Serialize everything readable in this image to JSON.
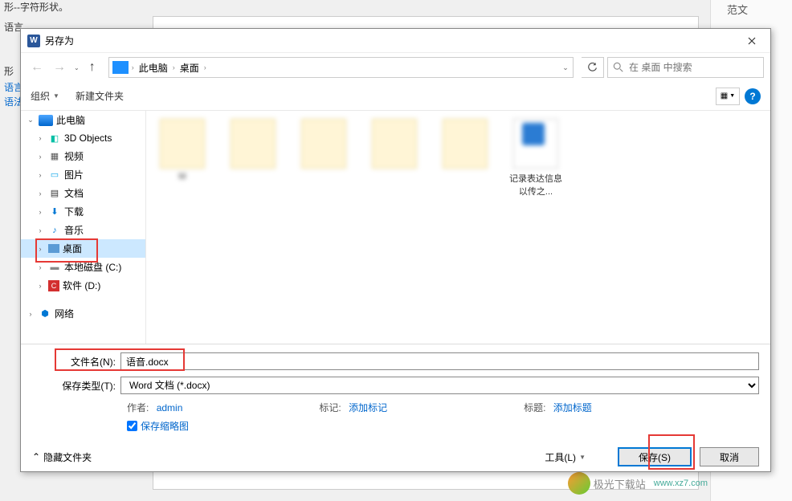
{
  "bg": {
    "text1": "形--字符形状。",
    "text2": "语言",
    "text3": "范文",
    "text4": "形",
    "text5": "语言",
    "text6": "语法"
  },
  "dialog": {
    "title": "另存为"
  },
  "nav": {
    "breadcrumb": {
      "root": "此电脑",
      "current": "桌面"
    },
    "search_placeholder": "在 桌面 中搜索",
    "refresh": "↻"
  },
  "toolbar": {
    "organize": "组织",
    "new_folder": "新建文件夹",
    "help": "?"
  },
  "tree": {
    "this_pc": "此电脑",
    "objects3d": "3D Objects",
    "videos": "视频",
    "pictures": "图片",
    "documents": "文档",
    "downloads": "下载",
    "music": "音乐",
    "desktop": "桌面",
    "local_c": "本地磁盘 (C:)",
    "software_d": "软件 (D:)",
    "network": "网络"
  },
  "files": {
    "items": [
      {
        "name": "M"
      },
      {
        "name": ""
      },
      {
        "name": ""
      },
      {
        "name": ""
      },
      {
        "name": ""
      },
      {
        "name": "记录表达信息以传之..."
      }
    ]
  },
  "footer": {
    "filename_label": "文件名(N):",
    "filename_value": "语音.docx",
    "filetype_label": "保存类型(T):",
    "filetype_value": "Word 文档 (*.docx)",
    "author_label": "作者:",
    "author_value": "admin",
    "tag_label": "标记:",
    "tag_value": "添加标记",
    "title_label": "标题:",
    "title_value": "添加标题",
    "thumbnail_label": "保存缩略图",
    "hide_folders": "隐藏文件夹",
    "tools": "工具(L)",
    "save": "保存(S)",
    "cancel": "取消"
  },
  "watermark": {
    "text": "极光下载站",
    "url": "www.xz7.com"
  }
}
